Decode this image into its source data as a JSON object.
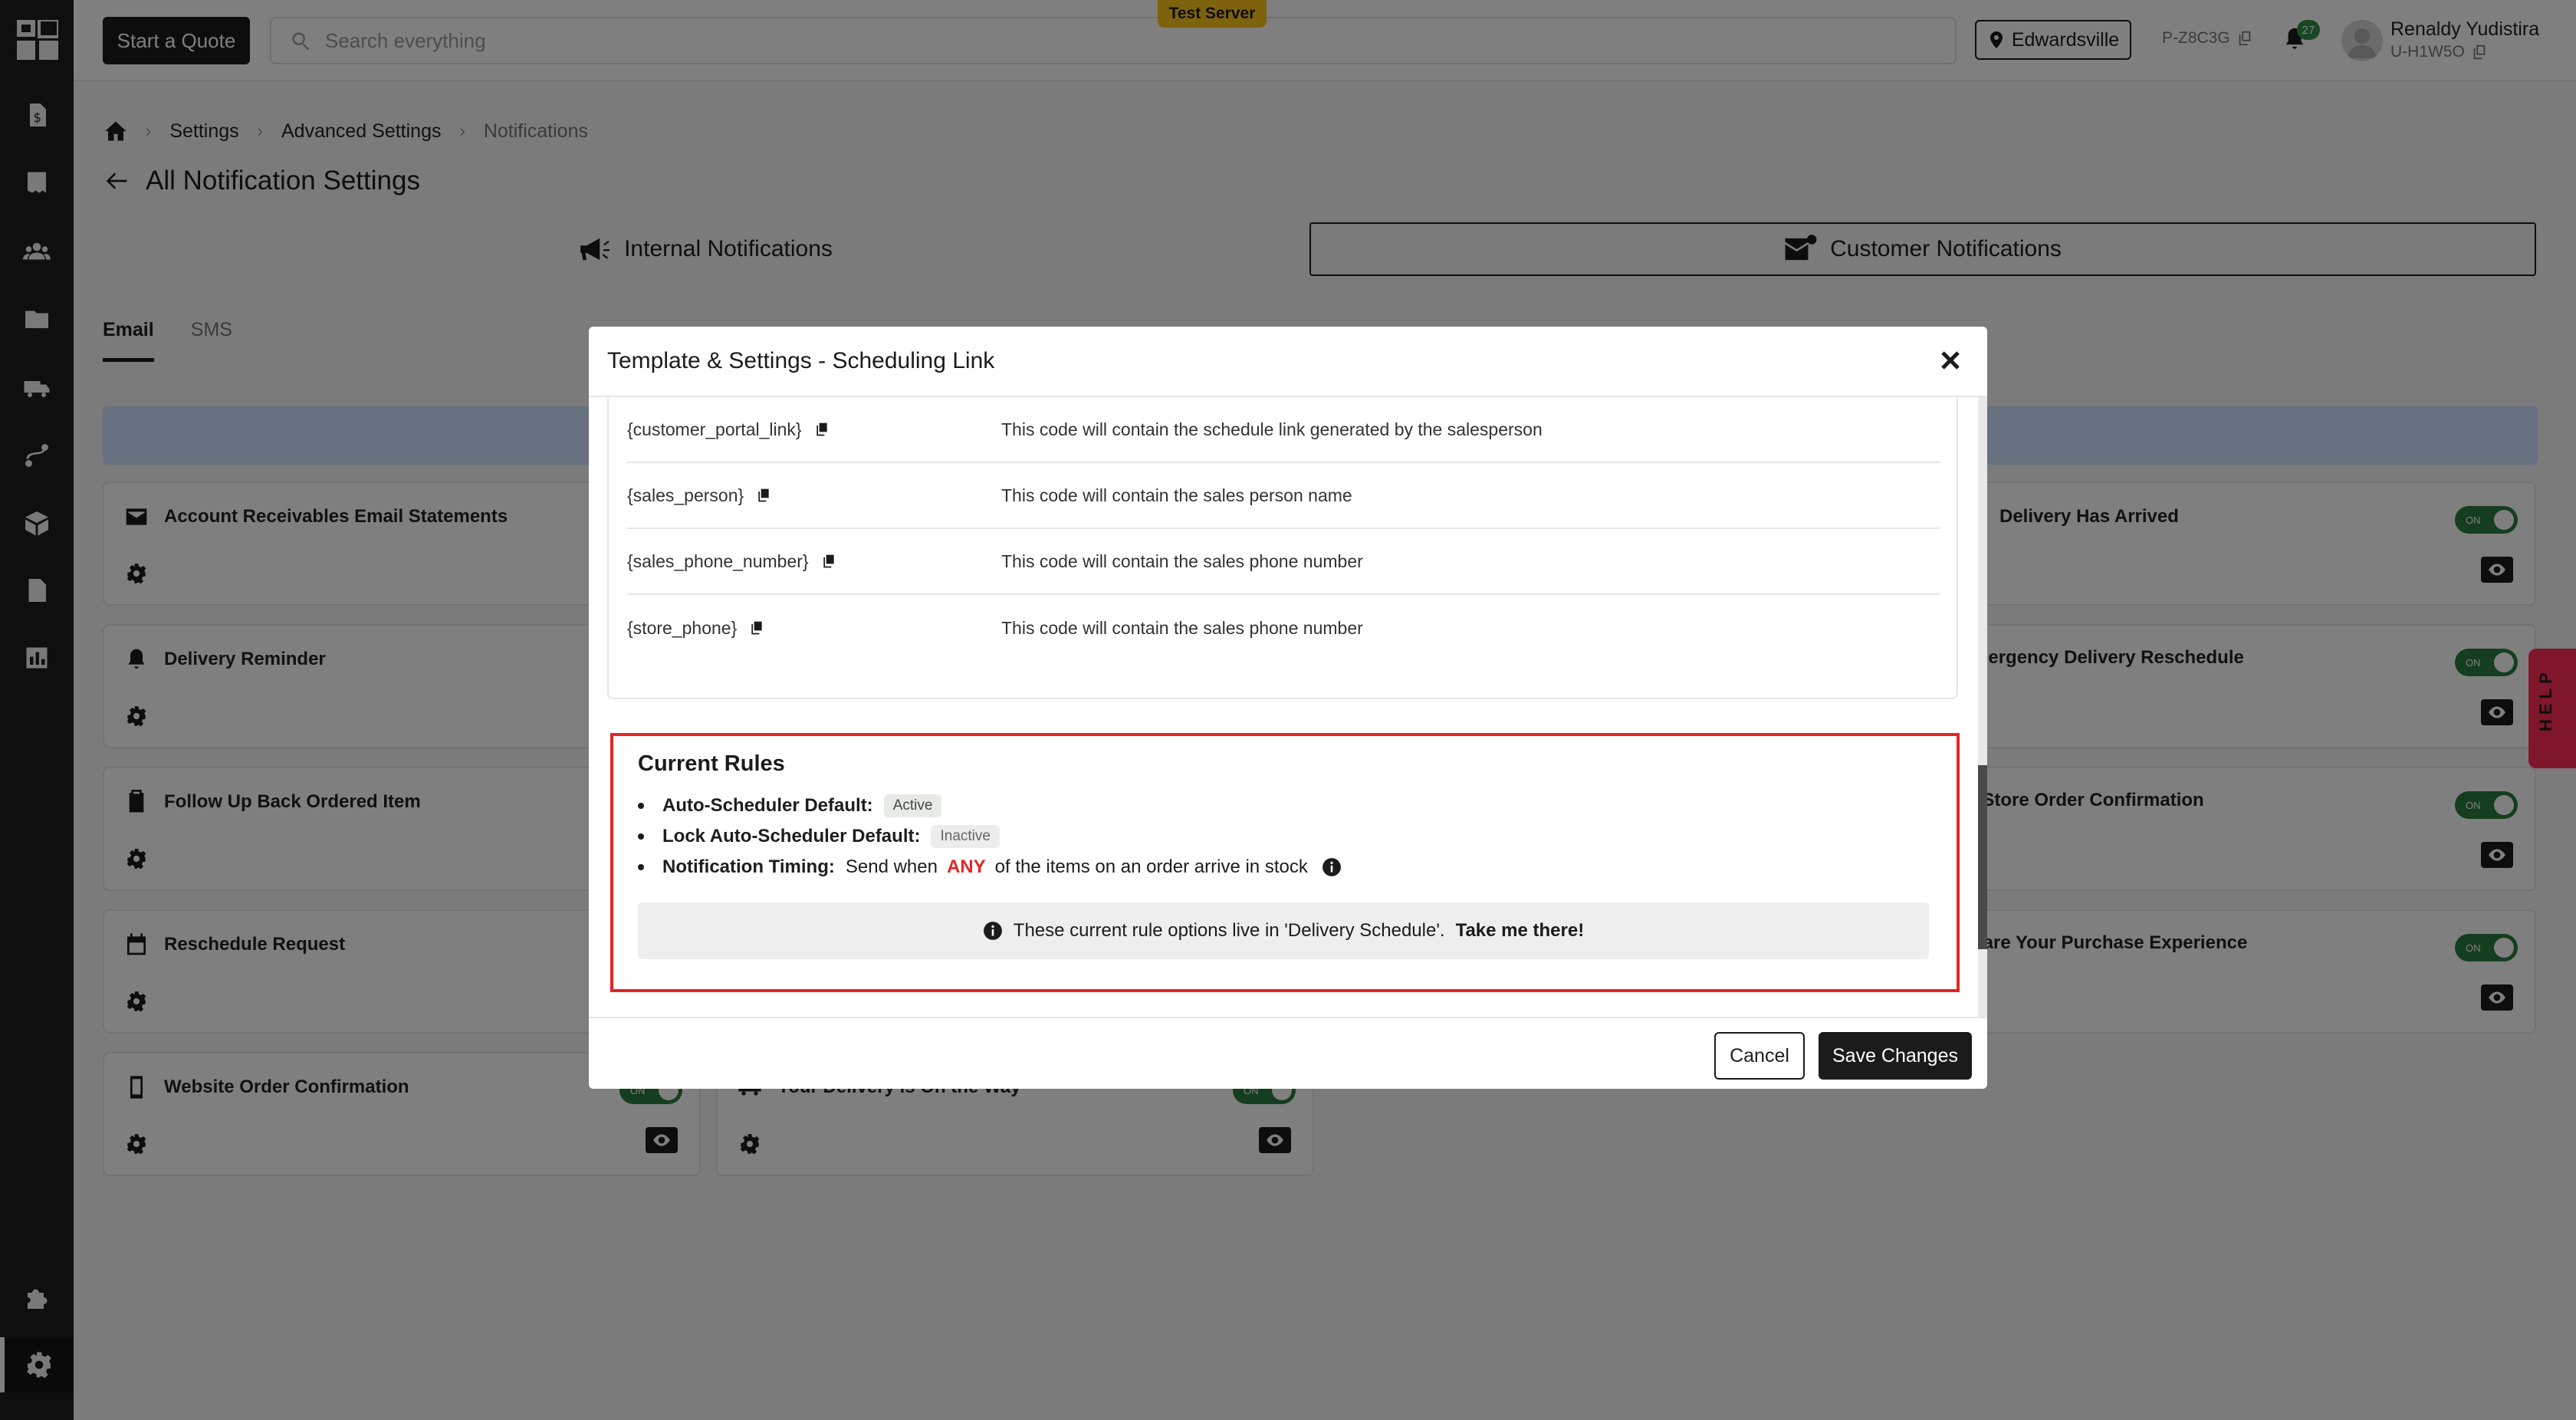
{
  "topbar": {
    "quote_button": "Start a Quote",
    "search_placeholder": "Search everything",
    "server_badge": "Test Server",
    "location": "Edwardsville",
    "p_code": "P-Z8C3G",
    "notification_count": "27",
    "user_name": "Renaldy Yudistira",
    "user_id": "U-H1W5O"
  },
  "sidebar": {
    "items": [
      "dollar-icon",
      "receipt-icon",
      "users-icon",
      "folder-icon",
      "truck-icon",
      "route-icon",
      "box-icon",
      "document-icon",
      "chart-icon",
      "puzzle-icon",
      "gear-icon"
    ]
  },
  "breadcrumb": {
    "items": [
      "Settings",
      "Advanced Settings",
      "Notifications"
    ]
  },
  "page": {
    "title": "All Notification Settings",
    "tab_internal": "Internal Notifications",
    "tab_customer": "Customer Notifications",
    "subtab_email": "Email",
    "subtab_sms": "SMS"
  },
  "cards": [
    {
      "title": "Account Receivables Email Statements",
      "icon": "mail-icon"
    },
    {
      "title": "Delivery Reminder",
      "icon": "bell-icon"
    },
    {
      "title": "Follow Up Back Ordered Item",
      "icon": "clipboard-icon"
    },
    {
      "title": "Reschedule Request",
      "icon": "calendar-icon"
    },
    {
      "title": "Website Order Confirmation",
      "icon": "phone-icon",
      "toggle": "ON"
    },
    {
      "title": "Your Delivery is On the Way",
      "icon": "truck-icon",
      "toggle": "ON"
    },
    {
      "title": "Delivery Has Arrived",
      "icon": "lock-icon",
      "toggle": "ON"
    },
    {
      "title": "Emergency Delivery Reschedule",
      "toggle": "ON"
    },
    {
      "title": "In-Store Order Confirmation",
      "toggle": "ON"
    },
    {
      "title": "Share Your Purchase Experience",
      "toggle": "ON"
    }
  ],
  "modal": {
    "title": "Template & Settings - Scheduling Link",
    "codes": [
      {
        "key": "{customer_portal_link}",
        "desc": "This code will contain the schedule link generated by the salesperson"
      },
      {
        "key": "{sales_person}",
        "desc": "This code will contain the sales person name"
      },
      {
        "key": "{sales_phone_number}",
        "desc": "This code will contain the sales phone number"
      },
      {
        "key": "{store_phone}",
        "desc": "This code will contain the sales phone number"
      }
    ],
    "rules": {
      "title": "Current Rules",
      "auto_label": "Auto-Scheduler Default:",
      "auto_value": "Active",
      "lock_label": "Lock Auto-Scheduler Default:",
      "lock_value": "Inactive",
      "timing_label": "Notification Timing:",
      "timing_prefix": "Send when",
      "timing_any": "ANY",
      "timing_suffix": "of the items on an order arrive in stock",
      "note_text": "These current rule options live in 'Delivery Schedule'.",
      "note_link": "Take me there!"
    },
    "cancel": "Cancel",
    "save": "Save Changes"
  },
  "help_tab": "HELP",
  "colors": {
    "accent": "#1b1b1b",
    "toggle_on": "#2a7a3e",
    "rules_border": "#e32626",
    "server_badge": "#fcc41c",
    "help": "#ff2d55"
  }
}
